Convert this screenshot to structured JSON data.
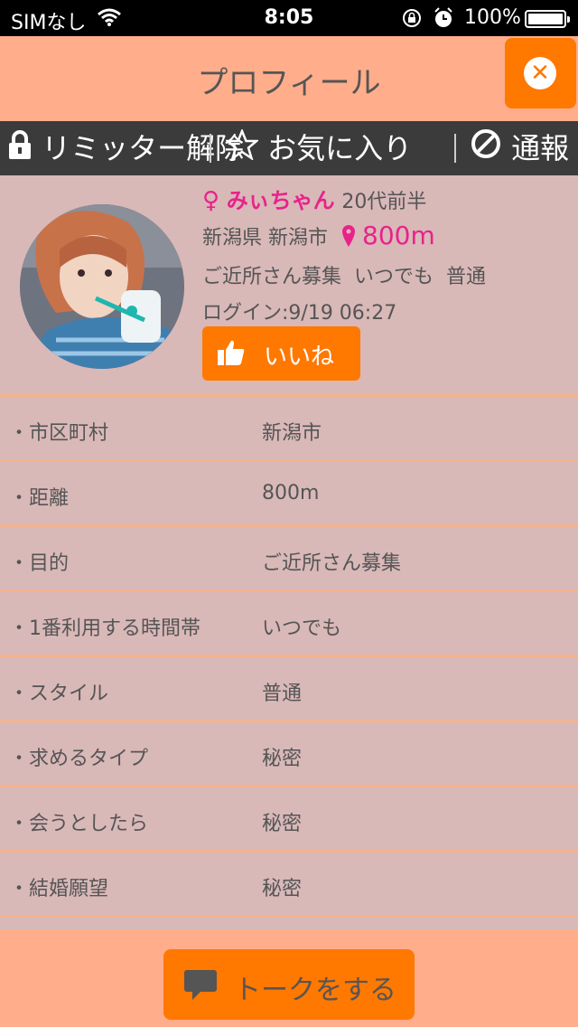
{
  "status_bar": {
    "carrier": "SIMなし",
    "time": "8:05",
    "battery": "100%"
  },
  "header": {
    "title": "プロフィール"
  },
  "actions": {
    "limiter": "リミッター解除",
    "favorite": "お気に入り",
    "report": "通報"
  },
  "profile": {
    "gender_symbol": "♀",
    "name": "みぃちゃん",
    "age": "20代前半",
    "location": "新潟県 新潟市",
    "distance": "800m",
    "purpose_summary": "ご近所さん募集  いつでも  普通",
    "login": "ログイン:9/19 06:27",
    "like_label": "いいね"
  },
  "details": [
    {
      "key": "・市区町村",
      "value": "新潟市"
    },
    {
      "key": "・距離",
      "value": "800m"
    },
    {
      "key": "・目的",
      "value": "ご近所さん募集"
    },
    {
      "key": "・1番利用する時間帯",
      "value": "いつでも"
    },
    {
      "key": "・スタイル",
      "value": "普通"
    },
    {
      "key": "・求めるタイプ",
      "value": "秘密"
    },
    {
      "key": "・会うとしたら",
      "value": "秘密"
    },
    {
      "key": "・結婚願望",
      "value": "秘密"
    }
  ],
  "bottom": {
    "talk_label": "トークをする"
  },
  "colors": {
    "accent": "#ff7800",
    "header_bg": "#ffad8a",
    "body_bg": "#d9b8b8",
    "pink": "#e8238a",
    "action_bar_bg": "#3b3b3b"
  }
}
